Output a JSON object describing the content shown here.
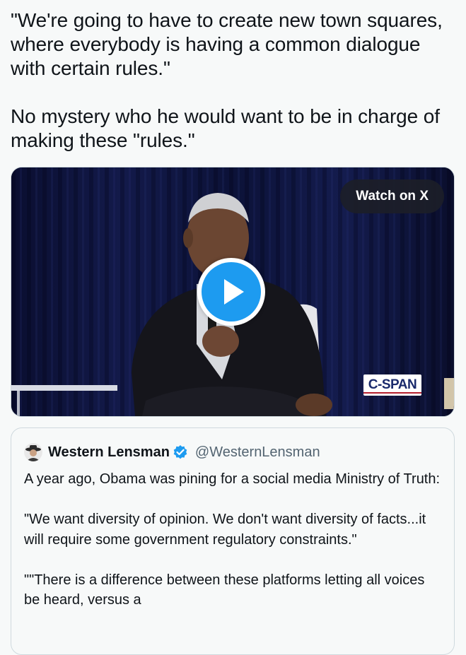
{
  "tweet": {
    "paragraphs": [
      "\"We're going to have to create new town squares, where everybody is having a common dialogue with certain rules.\"",
      "No mystery who he would want to be in charge of making these \"rules.\""
    ]
  },
  "media": {
    "watch_label": "Watch on X",
    "network_logo": "C-SPAN",
    "play_icon": "play-icon",
    "accent": "#1d9bf0"
  },
  "quoted_tweet": {
    "author_name": "Western Lensman",
    "handle": "@WesternLensman",
    "verified_icon": "verified-badge-icon",
    "paragraphs": [
      "A year ago, Obama was pining for a social media Ministry of Truth:",
      "\"We want diversity of opinion. We don't want diversity of facts...it will require some government regulatory constraints.\"",
      "\"\"There is a difference between these platforms letting all voices be heard, versus a"
    ]
  },
  "colors": {
    "background": "#f7f9f9",
    "text": "#0f1419",
    "secondary_text": "#536471",
    "border": "#cfd9de",
    "verified": "#1d9bf0"
  }
}
